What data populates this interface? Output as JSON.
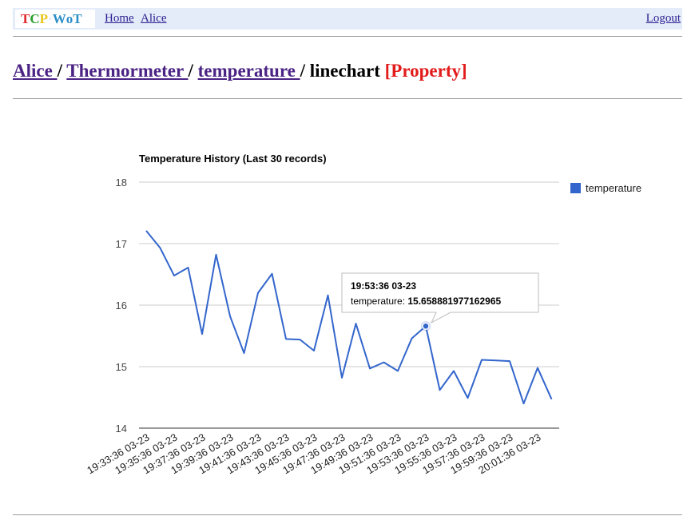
{
  "navbar": {
    "logo": [
      {
        "char": "T",
        "color": "#e3272b"
      },
      {
        "char": "C",
        "color": "#2aa02b"
      },
      {
        "char": "P",
        "color": "#e8c61b"
      },
      {
        "char": "·",
        "color": "#d8e4f4"
      },
      {
        "char": "W",
        "color": "#2b8fc8"
      },
      {
        "char": "o",
        "color": "#2b8fc8"
      },
      {
        "char": "T",
        "color": "#2b8fc8"
      }
    ],
    "home_label": "Home",
    "user_label": "Alice",
    "logout_label": "Logout"
  },
  "breadcrumb": {
    "user": "Alice ",
    "device": "Thermormeter ",
    "property": "temperature ",
    "view": "linechart",
    "sep": " / ",
    "tag": "[Property]"
  },
  "chart_data": {
    "type": "line",
    "title": "Temperature History (Last 30 records)",
    "xlabel": "",
    "ylabel": "",
    "ylim": [
      14,
      18
    ],
    "yticks": [
      14,
      15,
      16,
      17,
      18
    ],
    "grid": true,
    "legend_position": "right",
    "series": [
      {
        "name": "temperature",
        "color": "#3366cc",
        "values": [
          17.21,
          16.93,
          16.48,
          16.61,
          15.53,
          16.82,
          15.82,
          15.22,
          16.2,
          16.51,
          15.45,
          15.44,
          15.26,
          16.16,
          14.82,
          15.7,
          14.97,
          15.07,
          14.93,
          15.46,
          15.658881977162965,
          14.62,
          14.93,
          14.49,
          15.11,
          15.1,
          15.09,
          14.4,
          14.98,
          14.47
        ]
      }
    ],
    "x_tick_labels": [
      "19:33:36 03-23",
      "19:35:36 03-23",
      "19:37:36 03-23",
      "19:39:36 03-23",
      "19:41:36 03-23",
      "19:43:36 03-23",
      "19:45:36 03-23",
      "19:47:36 03-23",
      "19:49:36 03-23",
      "19:51:36 03-23",
      "19:53:36 03-23",
      "19:55:36 03-23",
      "19:57:36 03-23",
      "19:59:36 03-23",
      "20:01:36 03-23"
    ],
    "tooltip": {
      "point_index": 20,
      "title": "19:53:36 03-23",
      "label": "temperature: ",
      "value": "15.658881977162965"
    }
  }
}
